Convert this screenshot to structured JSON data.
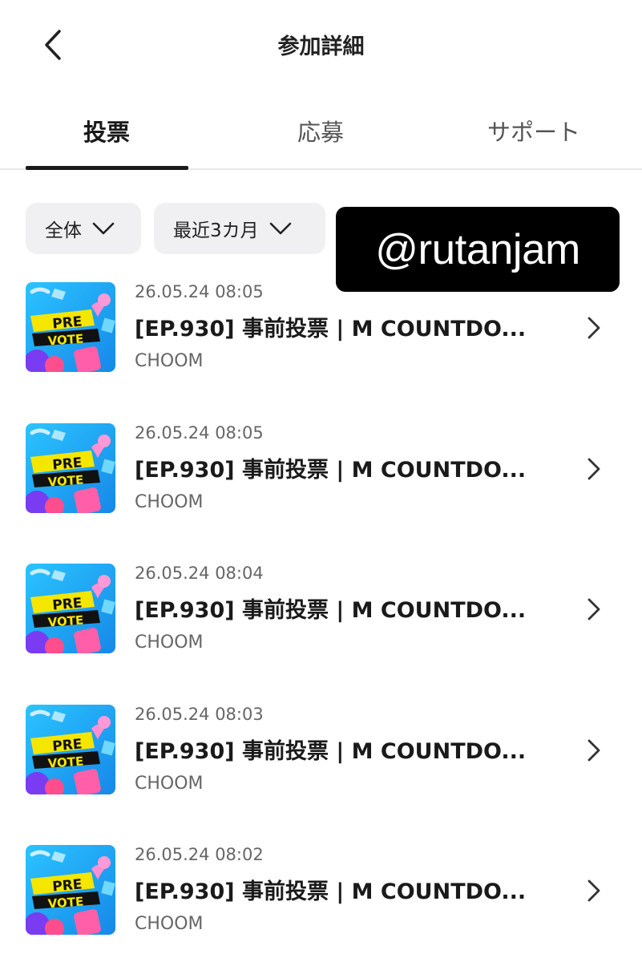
{
  "header": {
    "title": "参加詳細",
    "back_icon": "chevron-left-icon"
  },
  "tabs": [
    {
      "label": "投票",
      "active": true
    },
    {
      "label": "応募",
      "active": false
    },
    {
      "label": "サポート",
      "active": false
    }
  ],
  "filters": [
    {
      "label": "全体",
      "icon": "chevron-down-icon"
    },
    {
      "label": "最近3カ月",
      "icon": "chevron-down-icon"
    }
  ],
  "watermark": "@rutanjam",
  "items": [
    {
      "date": "26.05.24 08:05",
      "title": "[EP.930] 事前投票 | M COUNTDO...",
      "source": "CHOOM",
      "thumb_line1": "PRE",
      "thumb_line2": "VOTE"
    },
    {
      "date": "26.05.24 08:05",
      "title": "[EP.930] 事前投票 | M COUNTDO...",
      "source": "CHOOM",
      "thumb_line1": "PRE",
      "thumb_line2": "VOTE"
    },
    {
      "date": "26.05.24 08:04",
      "title": "[EP.930] 事前投票 | M COUNTDO...",
      "source": "CHOOM",
      "thumb_line1": "PRE",
      "thumb_line2": "VOTE"
    },
    {
      "date": "26.05.24 08:03",
      "title": "[EP.930] 事前投票 | M COUNTDO...",
      "source": "CHOOM",
      "thumb_line1": "PRE",
      "thumb_line2": "VOTE"
    },
    {
      "date": "26.05.24 08:02",
      "title": "[EP.930] 事前投票 | M COUNTDO...",
      "source": "CHOOM",
      "thumb_line1": "PRE",
      "thumb_line2": "VOTE"
    }
  ],
  "colors": {
    "thumb_bg": "#1aa0f0",
    "thumb_label_bg": "#f5e600",
    "thumb_label_dark": "#111111",
    "accent_pink": "#ff6fb0",
    "text_primary": "#1a1a1a",
    "text_secondary": "#666666"
  }
}
